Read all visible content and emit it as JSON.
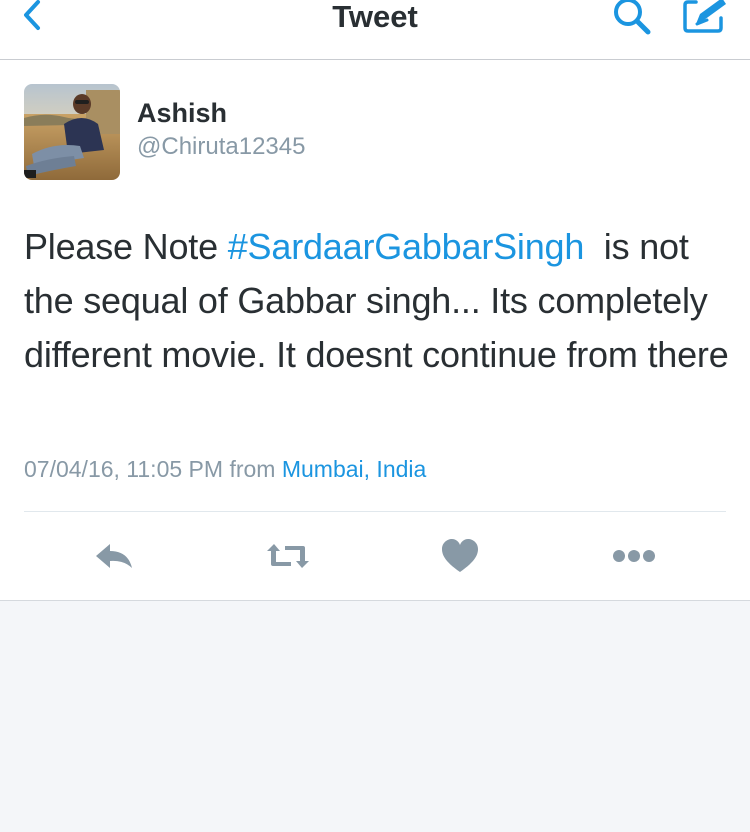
{
  "nav": {
    "title": "Tweet",
    "back_icon": "chevron-left-icon",
    "search_icon": "search-icon",
    "compose_icon": "compose-icon",
    "accent_color": "#1b95e0"
  },
  "tweet": {
    "author": {
      "name": "Ashish",
      "handle": "@Chiruta12345"
    },
    "text": {
      "part1": "Please Note ",
      "hashtag": "#SardaarGabbarSingh",
      "part2": "  is not the sequal of Gabbar singh... Its completely different movie. It doesnt continue from there"
    },
    "timestamp": "07/04/16, 11:05 PM",
    "from_label": "from",
    "location": "Mumbai, India",
    "actions": {
      "reply_icon": "reply-icon",
      "retweet_icon": "retweet-icon",
      "like_icon": "heart-icon",
      "more_icon": "more-icon"
    }
  }
}
